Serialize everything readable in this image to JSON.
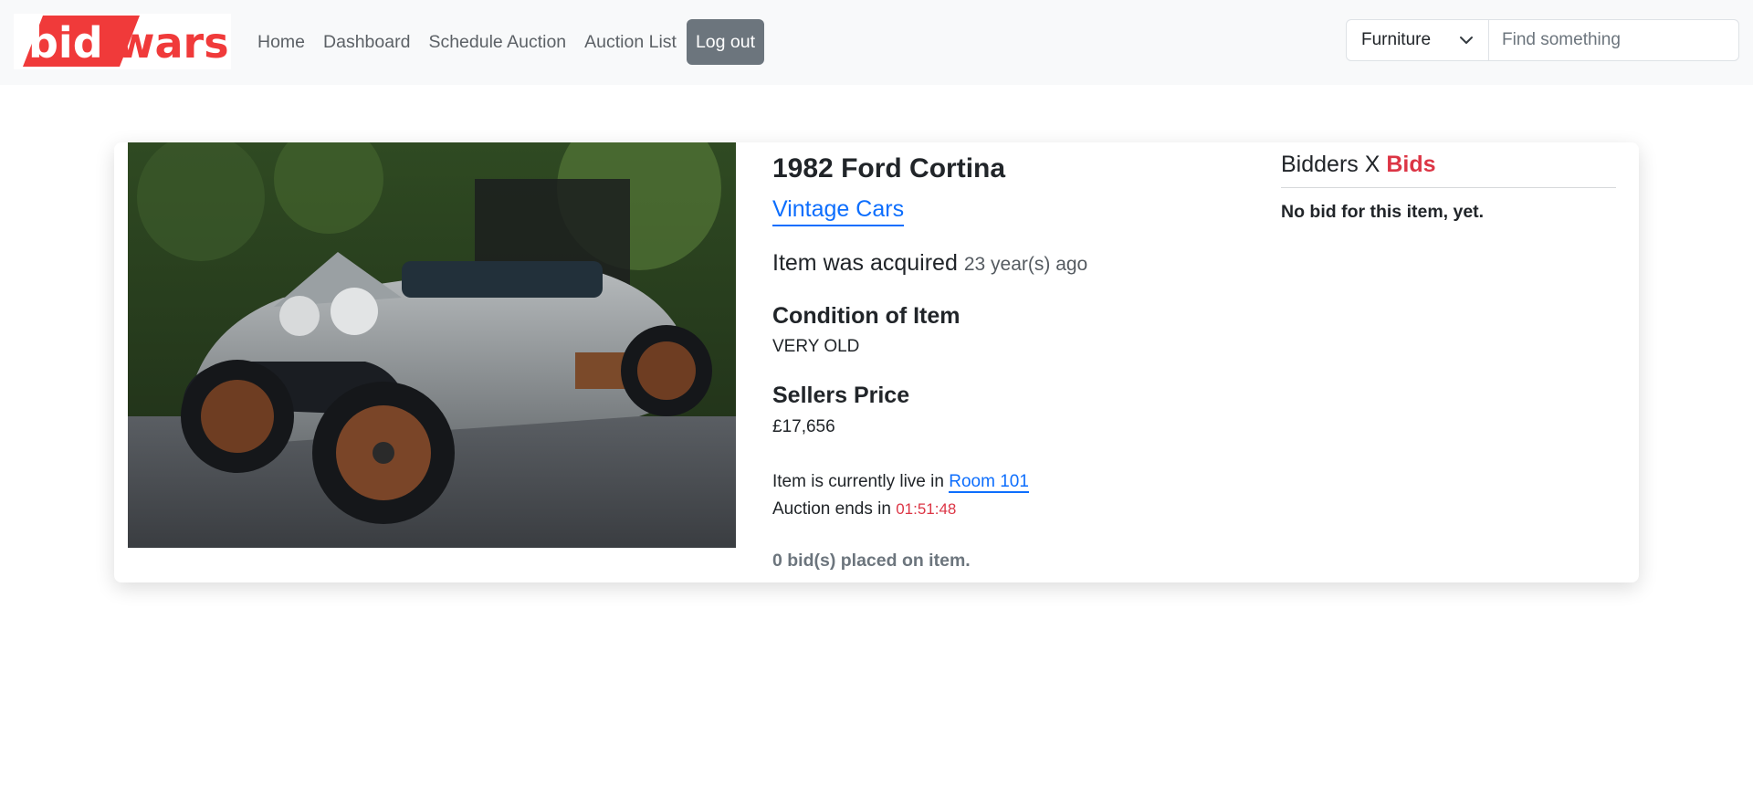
{
  "brand": {
    "logo_part1": "bid",
    "logo_part2": "wars."
  },
  "nav": {
    "links": [
      "Home",
      "Dashboard",
      "Schedule Auction",
      "Auction List"
    ],
    "logout_label": "Log out"
  },
  "search": {
    "category_selected": "Furniture",
    "placeholder": "Find something"
  },
  "item": {
    "title": "1982 Ford Cortina",
    "category": "Vintage Cars",
    "acquired_label": "Item was acquired",
    "acquired_ago": "23 year(s) ago",
    "condition_heading": "Condition of Item",
    "condition_value": "VERY OLD",
    "price_heading": "Sellers Price",
    "price_value": "£17,656",
    "live_prefix": "Item is currently live in",
    "room": "Room 101",
    "ends_prefix": "Auction ends in",
    "countdown": "01:51:48",
    "bids_placed": "0 bid(s) placed on item."
  },
  "bids_panel": {
    "heading_prefix": "Bidders X",
    "heading_accent": "Bids",
    "empty_message": "No bid for this item, yet."
  },
  "colors": {
    "brand_red": "#f03a3a",
    "link_blue": "#0d6efd",
    "danger": "#dc3545",
    "logout_bg": "#6c757d",
    "navbar_bg": "#f8f9fa"
  }
}
